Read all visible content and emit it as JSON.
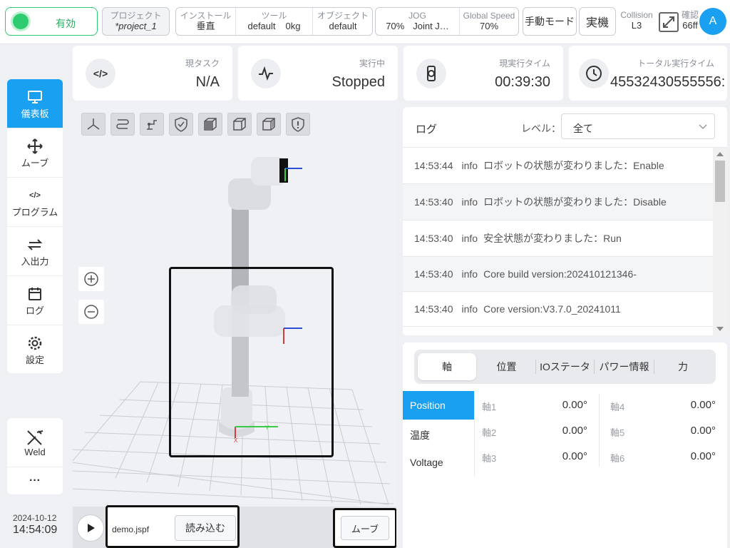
{
  "topbar": {
    "enable_label": "有効",
    "project_label": "プロジェクト",
    "project_value": "*project_1",
    "install_label": "インストール",
    "install_value": "垂直",
    "tool_label": "ツール",
    "tool_value": "default",
    "tool_weight": "0kg",
    "object_label": "オブジェクト",
    "object_value": "default",
    "jog_label": "JOG",
    "jog_speed": "70%",
    "jog_mode": "Joint J…",
    "global_speed_label": "Global Speed",
    "global_speed_value": "70%",
    "manual_mode_label": "手動モード",
    "real_label": "実機",
    "collision_label": "Collision",
    "collision_value": "L3",
    "confirm_label": "確認",
    "confirm_value": "66ff",
    "avatar_letter": "A"
  },
  "status_cards": {
    "task_label": "現タスク",
    "task_value": "N/A",
    "exec_label": "実行中",
    "exec_value": "Stopped",
    "current_time_label": "現実行タイム",
    "current_time_value": "00:39:30",
    "total_time_label": "トータル実行タイム",
    "total_time_value": "45532430555556:"
  },
  "sidebar": {
    "items": [
      {
        "label": "儀表板",
        "icon": "monitor-icon"
      },
      {
        "label": "ムーブ",
        "icon": "move-icon"
      },
      {
        "label": "プログラム",
        "icon": "code-icon"
      },
      {
        "label": "入出力",
        "icon": "swap-icon"
      },
      {
        "label": "ログ",
        "icon": "calendar-icon"
      },
      {
        "label": "設定",
        "icon": "gear-icon"
      }
    ],
    "weld_label": "Weld",
    "more_label": "···",
    "date": "2024-10-12",
    "time": "14:54:09"
  },
  "viewer": {
    "file_name": "demo.jspf",
    "load_label": "読み込む",
    "move_label": "ムーブ"
  },
  "log": {
    "title": "ログ",
    "level_label": "レベル：",
    "level_value": "全て",
    "entries": [
      {
        "time": "14:53:44",
        "level": "info",
        "message": "ロボットの状態が変わりました：Enable"
      },
      {
        "time": "14:53:40",
        "level": "info",
        "message": "ロボットの状態が変わりました：Disable"
      },
      {
        "time": "14:53:40",
        "level": "info",
        "message": "安全状態が変わりました：Run"
      },
      {
        "time": "14:53:40",
        "level": "info",
        "message": "Core build version:202410121346-"
      },
      {
        "time": "14:53:40",
        "level": "info",
        "message": "Core version:V3.7.0_20241011"
      }
    ]
  },
  "status_panel": {
    "tabs": [
      "軸",
      "位置",
      "IOステータ",
      "パワー情報",
      "力"
    ],
    "side_tabs": [
      "Position",
      "温度",
      "Voltage"
    ],
    "joints": [
      {
        "label": "軸1",
        "value": "0.00°"
      },
      {
        "label": "軸2",
        "value": "0.00°"
      },
      {
        "label": "軸3",
        "value": "0.00°"
      },
      {
        "label": "軸4",
        "value": "0.00°"
      },
      {
        "label": "軸5",
        "value": "0.00°"
      },
      {
        "label": "軸6",
        "value": "0.00°"
      }
    ]
  },
  "colors": {
    "accent": "#1aa0f0",
    "enable_green": "#2ecc71"
  }
}
